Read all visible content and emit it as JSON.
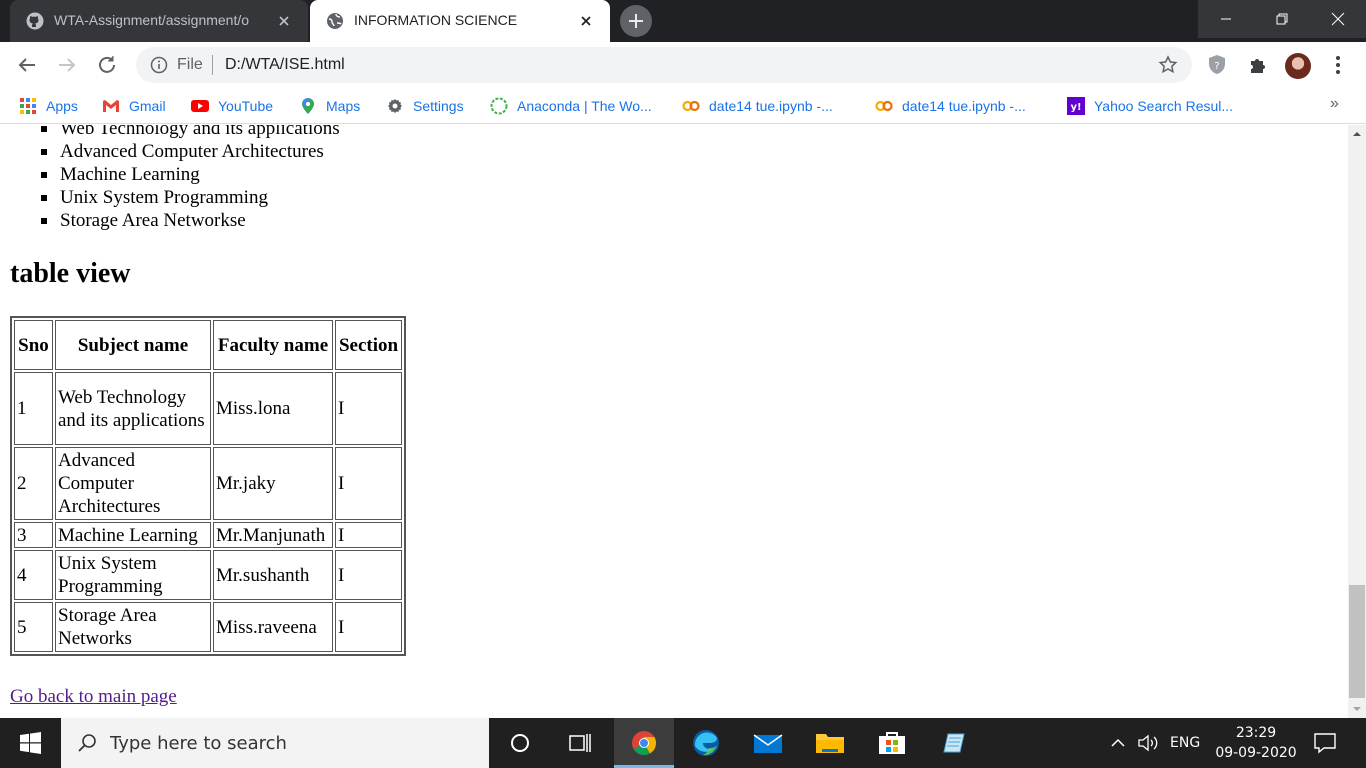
{
  "browser": {
    "tabs": [
      {
        "title": "WTA-Assignment/assignment/o",
        "favicon": "github-icon",
        "active": false
      },
      {
        "title": "INFORMATION SCIENCE",
        "favicon": "globe-icon",
        "active": true
      }
    ],
    "address": {
      "scheme_label": "File",
      "url": "D:/WTA/ISE.html"
    },
    "bookmarks": [
      {
        "label": "Apps",
        "icon": "apps-grid-icon"
      },
      {
        "label": "Gmail",
        "icon": "gmail-icon"
      },
      {
        "label": "YouTube",
        "icon": "youtube-icon"
      },
      {
        "label": "Maps",
        "icon": "maps-pin-icon"
      },
      {
        "label": "Settings",
        "icon": "gear-icon"
      },
      {
        "label": "Anaconda | The Wo...",
        "icon": "anaconda-icon"
      },
      {
        "label": "date14 tue.ipynb -...",
        "icon": "colab-icon"
      },
      {
        "label": "date14 tue.ipynb -...",
        "icon": "colab-icon"
      },
      {
        "label": "Yahoo Search Resul...",
        "icon": "yahoo-icon"
      }
    ],
    "bookmarks_overflow": "»"
  },
  "page": {
    "list_items": [
      "Web Technology and its applications",
      "Advanced Computer Architectures",
      "Machine Learning",
      "Unix System Programming",
      "Storage Area Networkse"
    ],
    "heading": "table view",
    "table": {
      "headers": [
        "Sno",
        "Subject name",
        "Faculty name",
        "Section"
      ],
      "rows": [
        [
          "1",
          "Web Technology and its applications",
          "Miss.lona",
          "I"
        ],
        [
          "2",
          "Advanced Computer Architectures",
          "Mr.jaky",
          "I"
        ],
        [
          "3",
          "Machine Learning",
          "Mr.Manjunath",
          "I"
        ],
        [
          "4",
          "Unix System Programming",
          "Mr.sushanth",
          "I"
        ],
        [
          "5",
          "Storage Area Networks",
          "Miss.raveena",
          "I"
        ]
      ]
    },
    "back_link": "Go back to main page"
  },
  "taskbar": {
    "search_placeholder": "Type here to search",
    "language": "ENG",
    "time": "23:29",
    "date": "09-09-2020"
  },
  "colors": {
    "tab_strip": "#202124",
    "link_visited": "#551a8b",
    "bookmark_text": "#1a73e8",
    "taskbar": "#202020"
  }
}
